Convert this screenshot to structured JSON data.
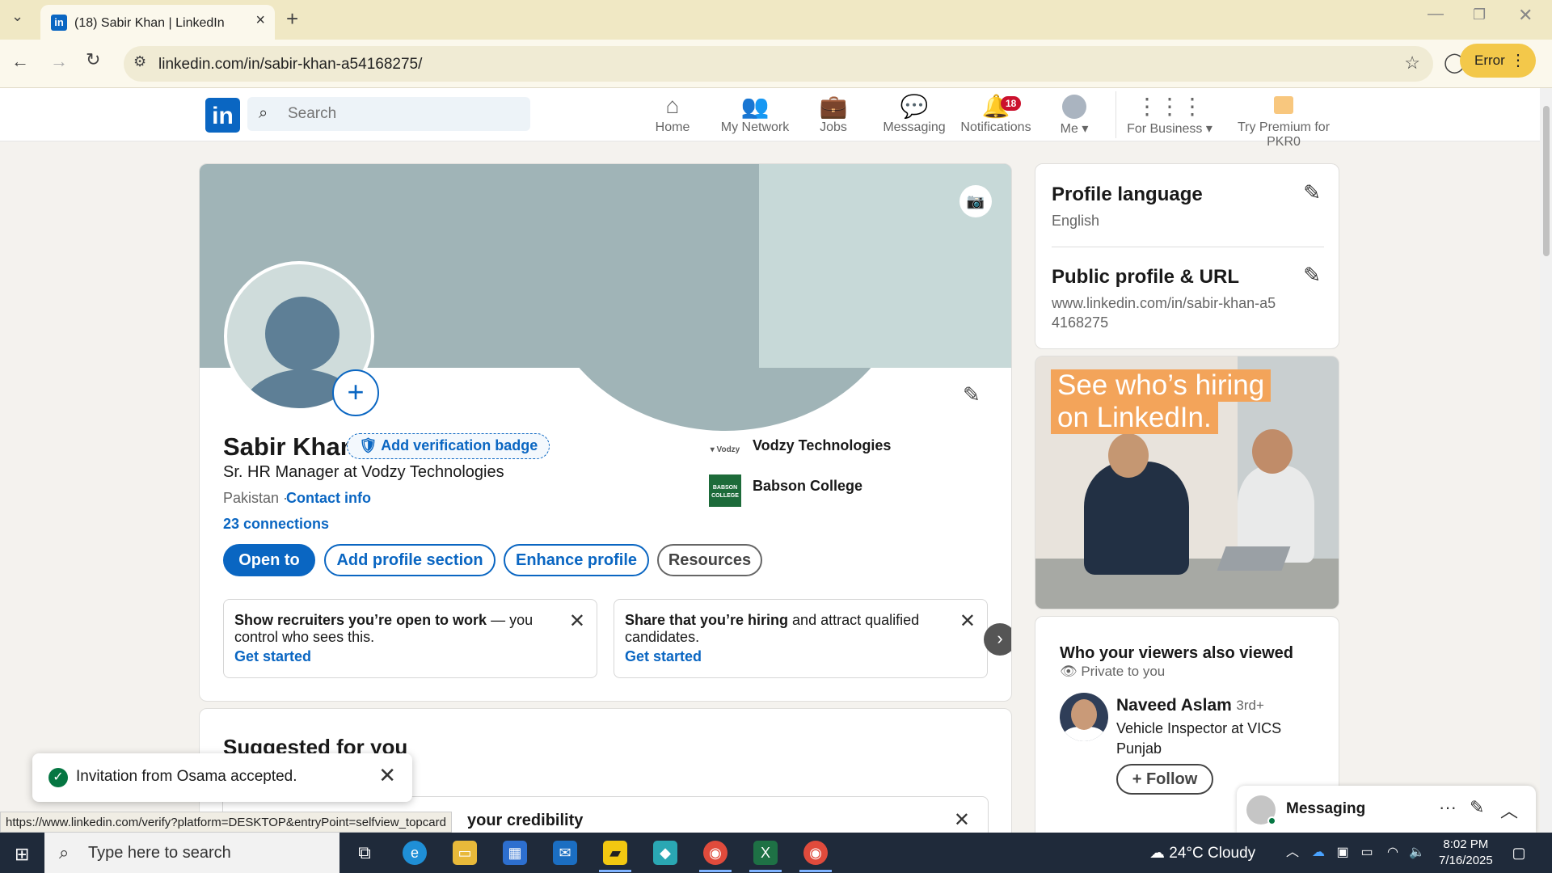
{
  "browser": {
    "tab_title": "(18) Sabir Khan | LinkedIn",
    "url": "linkedin.com/in/sabir-khan-a54168275/",
    "profile_button": "Error",
    "status_link": "https://www.linkedin.com/verify?platform=DESKTOP&entryPoint=selfview_topcard"
  },
  "nav": {
    "logo": "in",
    "search_placeholder": "Search",
    "items": [
      {
        "label": "Home",
        "icon": "home-icon"
      },
      {
        "label": "My Network",
        "icon": "network-icon"
      },
      {
        "label": "Jobs",
        "icon": "jobs-icon"
      },
      {
        "label": "Messaging",
        "icon": "messaging-icon"
      },
      {
        "label": "Notifications",
        "icon": "bell-icon",
        "badge": "18"
      },
      {
        "label": "Me",
        "icon": "avatar-icon"
      },
      {
        "label": "For Business",
        "icon": "grid-icon"
      },
      {
        "label": "Try Premium for PKR0",
        "icon": "premium-icon"
      }
    ]
  },
  "profile": {
    "name": "Sabir Khan",
    "verify_label": "Add verification badge",
    "headline": "Sr. HR Manager at Vodzy Technologies",
    "location": "Pakistan",
    "contact_info": "Contact info",
    "connections": "23 connections",
    "organizations": [
      {
        "name": "Vodzy Technologies"
      },
      {
        "name": "Babson College"
      }
    ],
    "actions": {
      "open_to": "Open to",
      "add_section": "Add profile section",
      "enhance": "Enhance profile",
      "resources": "Resources"
    },
    "promos": [
      {
        "bold": "Show recruiters you’re open to work",
        "rest": " — you control who sees this.",
        "cta": "Get started"
      },
      {
        "bold": "Share that you’re hiring",
        "rest": " and attract qualified candidates.",
        "cta": "Get started"
      }
    ]
  },
  "suggested": {
    "title": "Suggested for you",
    "item_text": "your credibility"
  },
  "sidebar": {
    "profile_language_title": "Profile language",
    "profile_language_value": "English",
    "public_profile_title": "Public profile & URL",
    "public_profile_url": "www.linkedin.com/in/sabir-khan-a54168275"
  },
  "ad": {
    "line1": "See who’s hiring",
    "line2": "on LinkedIn."
  },
  "viewers": {
    "title": "Who your viewers also viewed",
    "subtitle": "Private to you",
    "person_name": "Naveed Aslam",
    "person_degree": "· 3rd+",
    "person_title": "Vehicle Inspector at VICS Punjab",
    "follow": "+ Follow"
  },
  "messaging": {
    "label": "Messaging"
  },
  "toast": {
    "text": "Invitation from Osama accepted."
  },
  "taskbar": {
    "search_placeholder": "Type here to search",
    "weather": "24°C  Cloudy",
    "time": "8:02 PM",
    "date": "7/16/2025"
  },
  "colors": {
    "brand": "#0a66c2",
    "badge": "#cb112d",
    "success": "#057642"
  }
}
